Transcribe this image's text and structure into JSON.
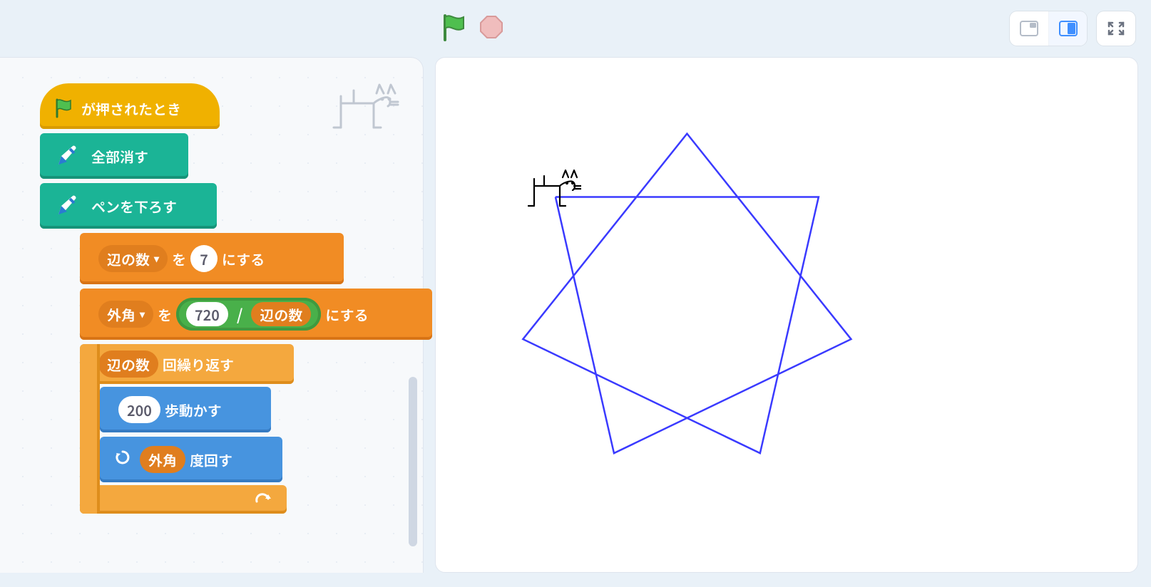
{
  "blocks": {
    "hat": {
      "label": "が押されたとき"
    },
    "eraseAll": {
      "label": "全部消す"
    },
    "penDown": {
      "label": "ペンを下ろす"
    },
    "setSides": {
      "varLabel": "辺の数",
      "mid": "を",
      "value": "7",
      "tail": "にする"
    },
    "setAngle": {
      "varLabel": "外角",
      "mid": "を",
      "numerator": "720",
      "opDivider": "/",
      "opVar": "辺の数",
      "tail": "にする"
    },
    "repeat": {
      "countVar": "辺の数",
      "label": "回繰り返す"
    },
    "move": {
      "value": "200",
      "label": "歩動かす"
    },
    "turn": {
      "varLabel": "外角",
      "label": "度回す"
    }
  },
  "chart_data": {
    "type": "line",
    "title": "",
    "description": "7-pointed star polygon drawn by pen (repeat 7: move 200, turn 720/7°)",
    "sides": 7,
    "step": 200,
    "turnDegrees": 102.857142857,
    "penColor": "#3a3aff"
  }
}
